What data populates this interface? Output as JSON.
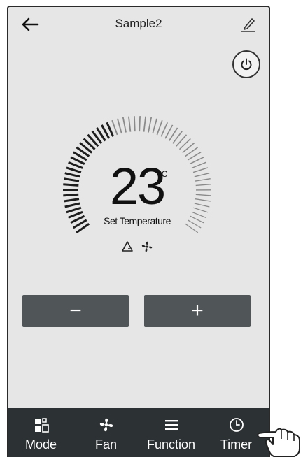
{
  "header": {
    "title": "Sample2",
    "back_icon": "arrow-left-icon",
    "edit_icon": "pencil-icon"
  },
  "power": {
    "icon": "power-icon"
  },
  "thermostat": {
    "temperature": "23",
    "unit": "°C",
    "label": "Set Temperature",
    "mode_icons": [
      "recycle-icon",
      "fan-icon"
    ]
  },
  "controls": {
    "minus_label": "−",
    "plus_label": "+"
  },
  "tabs": [
    {
      "label": "Mode",
      "icon": "mode-grid-icon"
    },
    {
      "label": "Fan",
      "icon": "fan-icon"
    },
    {
      "label": "Function",
      "icon": "menu-lines-icon"
    },
    {
      "label": "Timer",
      "icon": "clock-icon"
    }
  ],
  "colors": {
    "background": "#e6e6e6",
    "button": "#505558",
    "tabbar": "#2c3134"
  }
}
